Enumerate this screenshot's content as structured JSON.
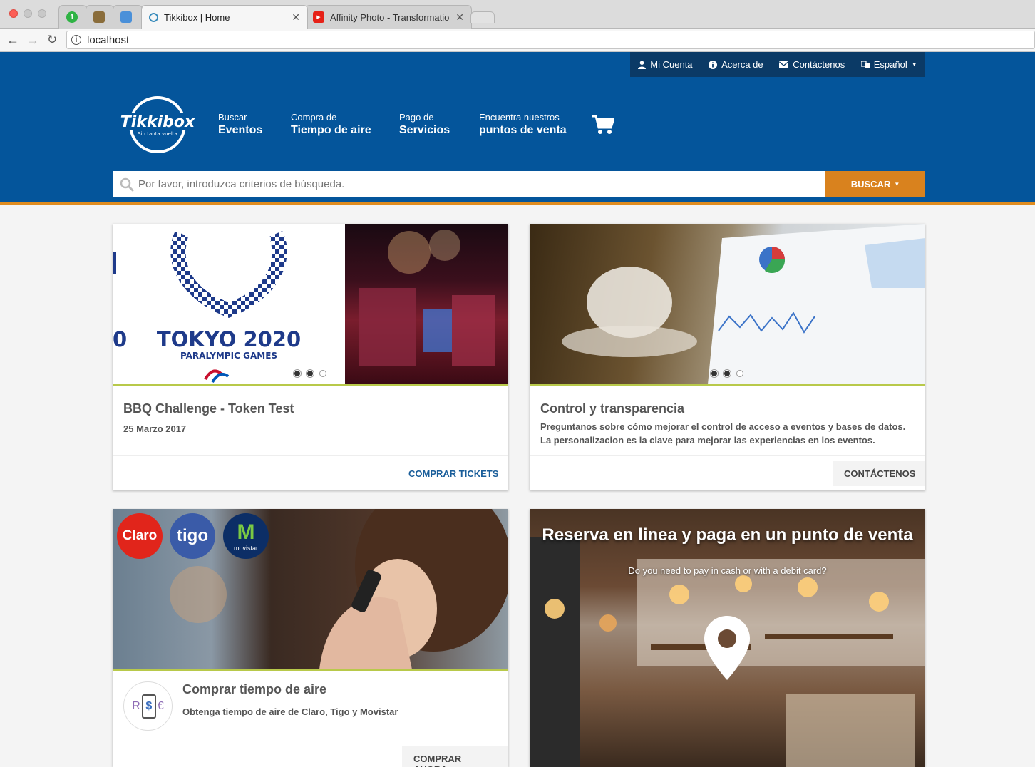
{
  "browser": {
    "tabs": [
      {
        "label": "",
        "fav_color": "#2fb344",
        "fav_text": "1"
      },
      {
        "label": "",
        "fav_color": "#8a6d3b",
        "fav_text": ""
      },
      {
        "label": "",
        "fav_color": "#4a90d9",
        "fav_text": ""
      },
      {
        "label": "Tikkibox | Home",
        "fav_color": "#3c8dbc",
        "fav_text": ""
      },
      {
        "label": "Affinity Photo - Transformatio",
        "fav_color": "#e62117",
        "fav_text": "▶"
      }
    ],
    "url": "localhost"
  },
  "header": {
    "util": {
      "account": "Mi Cuenta",
      "about": "Acerca de",
      "contact": "Contáctenos",
      "language": "Español"
    },
    "logo": {
      "name": "Tikkibox",
      "tagline": "Sin tanta vuelta"
    },
    "nav": [
      {
        "small": "Buscar",
        "big": "Eventos"
      },
      {
        "small": "Compra de",
        "big": "Tiempo de aire"
      },
      {
        "small": "Pago de",
        "big": "Servicios"
      },
      {
        "small": "Encuentra nuestros",
        "big": "puntos de venta"
      }
    ],
    "search": {
      "placeholder": "Por favor, introduzca criterios de búsqueda.",
      "button": "BUSCAR"
    }
  },
  "cards": {
    "event": {
      "title": "BBQ Challenge - Token Test",
      "date": "25 Marzo 2017",
      "action": "COMPRAR TICKETS",
      "image_text_big": "TOKYO 2020",
      "image_text_small": "PARALYMPIC GAMES"
    },
    "control": {
      "title": "Control y transparencia",
      "line1": "Preguntanos sobre cómo mejorar el control de acceso a eventos y bases de datos.",
      "line2": "La personalizacion es la clave para mejorar las experiencias en los eventos.",
      "action": "CONTÁCTENOS"
    },
    "airtime": {
      "title": "Comprar tiempo de aire",
      "description": "Obtenga tiempo de aire de Claro, Tigo y Movistar",
      "action": "COMPRAR AHORA",
      "carriers": [
        "Claro",
        "tigo",
        "movistar"
      ]
    },
    "pos": {
      "title": "Reserva en linea y paga en un punto de venta",
      "subtitle": "Do you need to pay in cash or with a debit card?"
    }
  },
  "colors": {
    "brand_blue": "#04559b",
    "util_dark": "#0b3a66",
    "accent_orange": "#d9821e",
    "link_blue": "#1a5e9a",
    "green_line": "#b8c94a"
  }
}
